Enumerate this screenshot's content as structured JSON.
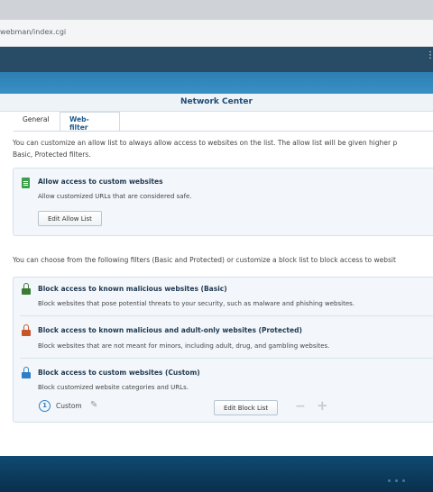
{
  "browser": {
    "url": "webman/index.cgi"
  },
  "window": {
    "title": "Network Center"
  },
  "tabs": [
    {
      "label": "General"
    },
    {
      "label": "Web-filter"
    }
  ],
  "allow_section": {
    "description_line1": "You can customize an allow list to always allow access to websites on the list. The allow list will be given higher p",
    "description_line2": "Basic, Protected filters.",
    "item": {
      "icon": "document-icon",
      "title": "Allow access to custom websites",
      "description": "Allow customized URLs that are considered safe.",
      "button_label": "Edit Allow List"
    }
  },
  "block_section": {
    "description": "You can choose from the following filters (Basic and Protected) or customize a block list to block access to websit",
    "items": [
      {
        "icon": "lock-icon",
        "icon_color": "#3b7a36",
        "title": "Block access to known malicious websites (Basic)",
        "description": "Block websites that pose potential threats to your security, such as malware and phishing websites."
      },
      {
        "icon": "lock-icon",
        "icon_color": "#c4562a",
        "title": "Block access to known malicious and adult-only websites (Protected)",
        "description": "Block websites that are not meant for minors, including adult, drug, and gambling websites."
      },
      {
        "icon": "lock-icon",
        "icon_color": "#2f7fc4",
        "title": "Block access to custom websites (Custom)",
        "description": "Block customized website categories and URLs."
      }
    ],
    "custom": {
      "count": "1",
      "label": "Custom",
      "button_label": "Edit Block List",
      "minus": "−",
      "plus": "+"
    }
  },
  "colors": {
    "accent": "#1d5c8c",
    "panel_bg": "#f3f7fb",
    "topbar": "#284b66",
    "desktop": "#3890c4"
  }
}
